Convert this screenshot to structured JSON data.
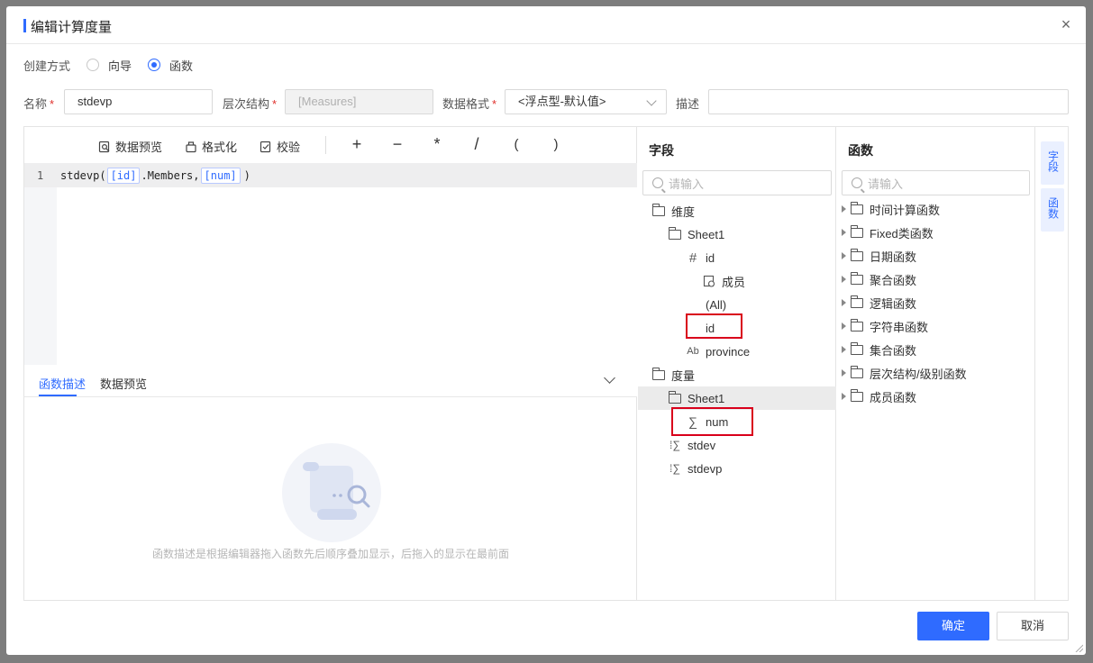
{
  "dialog": {
    "title": "编辑计算度量",
    "close_icon": "close-icon"
  },
  "method": {
    "label": "创建方式",
    "options": [
      {
        "label": "向导",
        "checked": false
      },
      {
        "label": "函数",
        "checked": true
      }
    ]
  },
  "form": {
    "name_label": "名称",
    "name_value": "stdevp",
    "hierarchy_label": "层次结构",
    "hierarchy_value": "[Measures]",
    "format_label": "数据格式",
    "format_value": "<浮点型-默认值>",
    "desc_label": "描述",
    "desc_value": "",
    "required_mark": "*"
  },
  "toolbar": {
    "preview_label": "数据预览",
    "format_label": "格式化",
    "validate_label": "校验",
    "ops": [
      "+",
      "−",
      "*",
      "/",
      "(",
      ")"
    ]
  },
  "editor": {
    "line_number": "1",
    "code_prefix": "stdevp(",
    "token_1": "[id]",
    "code_mid": ".Members,",
    "token_2": "[num]",
    "code_suffix": ")"
  },
  "desc_panel": {
    "tabs": [
      "函数描述",
      "数据预览"
    ],
    "active_tab": 0,
    "empty_text": "函数描述是根据编辑器拖入函数先后顺序叠加显示，后拖入的显示在最前面"
  },
  "fields": {
    "title": "字段",
    "search_placeholder": "请输入",
    "tree": {
      "dim_label": "维度",
      "dim_sheet": "Sheet1",
      "field_id": "id",
      "members": "成员",
      "all": "(All)",
      "id_leaf": "id",
      "province": "province",
      "measure_label": "度量",
      "measure_sheet": "Sheet1",
      "num": "num",
      "stdev": "stdev",
      "stdevp": "stdevp"
    }
  },
  "functions": {
    "title": "函数",
    "search_placeholder": "请输入",
    "groups": [
      "时间计算函数",
      "Fixed类函数",
      "日期函数",
      "聚合函数",
      "逻辑函数",
      "字符串函数",
      "集合函数",
      "层次结构/级别函数",
      "成员函数"
    ]
  },
  "side_tabs": [
    "字段",
    "函数"
  ],
  "footer": {
    "ok_label": "确定",
    "cancel_label": "取消"
  },
  "colors": {
    "accent": "#2f6bff",
    "highlight_box": "#d9001b"
  }
}
